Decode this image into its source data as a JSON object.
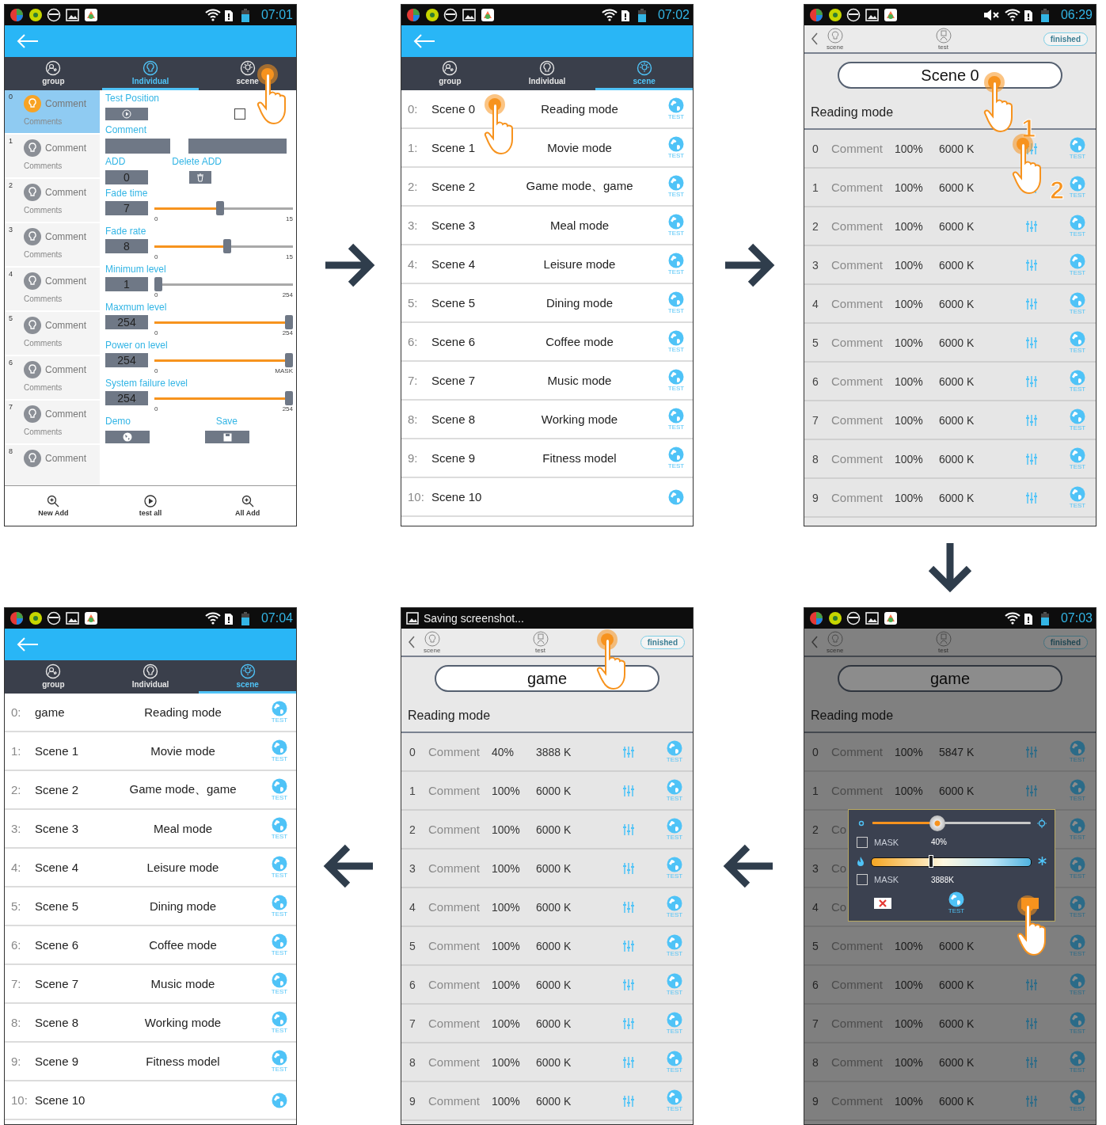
{
  "screens": [
    {
      "kind": "individual",
      "status": {
        "time": "07:01",
        "sound_muted": false
      },
      "tabs": [
        {
          "label": "group",
          "selected": false
        },
        {
          "label": "Individual",
          "selected": true
        },
        {
          "label": "scene",
          "selected": false
        }
      ],
      "devices": [
        {
          "number": "0",
          "title": "Comment",
          "subtitle": "Comments",
          "selected": true
        },
        {
          "number": "1",
          "title": "Comment",
          "subtitle": "Comments",
          "selected": false
        },
        {
          "number": "2",
          "title": "Comment",
          "subtitle": "Comments",
          "selected": false
        },
        {
          "number": "3",
          "title": "Comment",
          "subtitle": "Comments",
          "selected": false
        },
        {
          "number": "4",
          "title": "Comment",
          "subtitle": "Comments",
          "selected": false
        },
        {
          "number": "5",
          "title": "Comment",
          "subtitle": "Comments",
          "selected": false
        },
        {
          "number": "6",
          "title": "Comment",
          "subtitle": "Comments",
          "selected": false
        },
        {
          "number": "7",
          "title": "Comment",
          "subtitle": "Comments",
          "selected": false
        },
        {
          "number": "8",
          "title": "Comment",
          "selected": false
        }
      ],
      "settings": {
        "test_position": {
          "label": "Test Position",
          "checked": false
        },
        "comment": {
          "label": "Comment"
        },
        "add": {
          "label": "ADD",
          "value": "0"
        },
        "delete_add": {
          "label": "Delete ADD"
        },
        "sliders": [
          {
            "label": "Fade time",
            "value": "7",
            "level": 0.47,
            "min": "0",
            "max": "15"
          },
          {
            "label": "Fade rate",
            "value": "8",
            "level": 0.53,
            "min": "0",
            "max": "15"
          },
          {
            "label": "Minimum level",
            "value": "1",
            "level": 0.0,
            "min": "0",
            "max": "254"
          },
          {
            "label": "Maxmum level",
            "value": "254",
            "level": 1.0,
            "min": "0",
            "max": "254"
          },
          {
            "label": "Power on level",
            "value": "254",
            "level": 1.0,
            "min": "0",
            "max": "MASK"
          },
          {
            "label": "System failure level",
            "value": "254",
            "level": 1.0,
            "min": "0",
            "max": "254"
          }
        ],
        "demo": {
          "label": "Demo"
        },
        "save": {
          "label": "Save"
        }
      },
      "bottom_nav": [
        {
          "label": "New Add"
        },
        {
          "label": "test all"
        },
        {
          "label": "All Add"
        }
      ],
      "pointers": [
        {
          "kind": "tap"
        }
      ]
    },
    {
      "kind": "scene_list",
      "status": {
        "time": "07:02",
        "sound_muted": false
      },
      "tabs": [
        {
          "label": "group",
          "selected": false
        },
        {
          "label": "Individual",
          "selected": false
        },
        {
          "label": "scene",
          "selected": true
        }
      ],
      "scenes": [
        {
          "index": "0:",
          "name": "Scene 0",
          "mode": "Reading mode",
          "badge": "TEST"
        },
        {
          "index": "1:",
          "name": "Scene 1",
          "mode": "Movie mode",
          "badge": "TEST"
        },
        {
          "index": "2:",
          "name": "Scene 2",
          "mode": "Game mode、game",
          "badge": "TEST"
        },
        {
          "index": "3:",
          "name": "Scene 3",
          "mode": "Meal mode",
          "badge": "TEST"
        },
        {
          "index": "4:",
          "name": "Scene 4",
          "mode": "Leisure mode",
          "badge": "TEST"
        },
        {
          "index": "5:",
          "name": "Scene 5",
          "mode": "Dining mode",
          "badge": "TEST"
        },
        {
          "index": "6:",
          "name": "Scene 6",
          "mode": "Coffee mode",
          "badge": "TEST"
        },
        {
          "index": "7:",
          "name": "Scene 7",
          "mode": "Music mode",
          "badge": "TEST"
        },
        {
          "index": "8:",
          "name": "Scene 8",
          "mode": "Working mode",
          "badge": "TEST"
        },
        {
          "index": "9:",
          "name": "Scene 9",
          "mode": "Fitness model",
          "badge": "TEST"
        },
        {
          "index": "10:",
          "name": "Scene 10"
        }
      ],
      "pointers": [
        {
          "kind": "tap"
        }
      ]
    },
    {
      "kind": "scene_edit",
      "status": {
        "time": "06:29",
        "sound_muted": true
      },
      "dimmed": false,
      "header": {
        "scene_label": "scene",
        "test_label": "test",
        "finished": "finished"
      },
      "name": "Scene 0",
      "subtitle": "Reading mode",
      "rows": [
        {
          "number": "0",
          "comment": "Comment",
          "brightness": "100%",
          "temp": "6000 K",
          "badge": "TEST"
        },
        {
          "number": "1",
          "comment": "Comment",
          "brightness": "100%",
          "temp": "6000 K",
          "badge": "TEST"
        },
        {
          "number": "2",
          "comment": "Comment",
          "brightness": "100%",
          "temp": "6000 K",
          "badge": "TEST"
        },
        {
          "number": "3",
          "comment": "Comment",
          "brightness": "100%",
          "temp": "6000 K",
          "badge": "TEST"
        },
        {
          "number": "4",
          "comment": "Comment",
          "brightness": "100%",
          "temp": "6000 K",
          "badge": "TEST"
        },
        {
          "number": "5",
          "comment": "Comment",
          "brightness": "100%",
          "temp": "6000 K",
          "badge": "TEST"
        },
        {
          "number": "6",
          "comment": "Comment",
          "brightness": "100%",
          "temp": "6000 K",
          "badge": "TEST"
        },
        {
          "number": "7",
          "comment": "Comment",
          "brightness": "100%",
          "temp": "6000 K",
          "badge": "TEST"
        },
        {
          "number": "8",
          "comment": "Comment",
          "brightness": "100%",
          "temp": "6000 K",
          "badge": "TEST"
        },
        {
          "number": "9",
          "comment": "Comment",
          "brightness": "100%",
          "temp": "6000 K",
          "badge": "TEST"
        }
      ],
      "pointers": [
        {
          "kind": "tap",
          "label": "1"
        },
        {
          "kind": "tap",
          "label": "2"
        }
      ]
    },
    {
      "kind": "scene_list",
      "status": {
        "time": "07:04",
        "sound_muted": false
      },
      "tabs": [
        {
          "label": "group",
          "selected": false
        },
        {
          "label": "Individual",
          "selected": false
        },
        {
          "label": "scene",
          "selected": true
        }
      ],
      "scenes": [
        {
          "index": "0:",
          "name": "game",
          "mode": "Reading mode",
          "badge": "TEST"
        },
        {
          "index": "1:",
          "name": "Scene 1",
          "mode": "Movie mode",
          "badge": "TEST"
        },
        {
          "index": "2:",
          "name": "Scene 2",
          "mode": "Game mode、game",
          "badge": "TEST"
        },
        {
          "index": "3:",
          "name": "Scene 3",
          "mode": "Meal mode",
          "badge": "TEST"
        },
        {
          "index": "4:",
          "name": "Scene 4",
          "mode": "Leisure mode",
          "badge": "TEST"
        },
        {
          "index": "5:",
          "name": "Scene 5",
          "mode": "Dining mode",
          "badge": "TEST"
        },
        {
          "index": "6:",
          "name": "Scene 6",
          "mode": "Coffee mode",
          "badge": "TEST"
        },
        {
          "index": "7:",
          "name": "Scene 7",
          "mode": "Music mode",
          "badge": "TEST"
        },
        {
          "index": "8:",
          "name": "Scene 8",
          "mode": "Working mode",
          "badge": "TEST"
        },
        {
          "index": "9:",
          "name": "Scene 9",
          "mode": "Fitness model",
          "badge": "TEST"
        },
        {
          "index": "10:",
          "name": "Scene 10"
        }
      ]
    },
    {
      "kind": "scene_edit",
      "status": {
        "notification": "Saving screenshot..."
      },
      "dimmed": false,
      "header": {
        "scene_label": "scene",
        "test_label": "test",
        "finished": "finished"
      },
      "name": "game",
      "subtitle": "Reading mode",
      "rows": [
        {
          "number": "0",
          "comment": "Comment",
          "brightness": "40%",
          "temp": "3888 K",
          "badge": "TEST"
        },
        {
          "number": "1",
          "comment": "Comment",
          "brightness": "100%",
          "temp": "6000 K",
          "badge": "TEST"
        },
        {
          "number": "2",
          "comment": "Comment",
          "brightness": "100%",
          "temp": "6000 K",
          "badge": "TEST"
        },
        {
          "number": "3",
          "comment": "Comment",
          "brightness": "100%",
          "temp": "6000 K",
          "badge": "TEST"
        },
        {
          "number": "4",
          "comment": "Comment",
          "brightness": "100%",
          "temp": "6000 K",
          "badge": "TEST"
        },
        {
          "number": "5",
          "comment": "Comment",
          "brightness": "100%",
          "temp": "6000 K",
          "badge": "TEST"
        },
        {
          "number": "6",
          "comment": "Comment",
          "brightness": "100%",
          "temp": "6000 K",
          "badge": "TEST"
        },
        {
          "number": "7",
          "comment": "Comment",
          "brightness": "100%",
          "temp": "6000 K",
          "badge": "TEST"
        },
        {
          "number": "8",
          "comment": "Comment",
          "brightness": "100%",
          "temp": "6000 K",
          "badge": "TEST"
        },
        {
          "number": "9",
          "comment": "Comment",
          "brightness": "100%",
          "temp": "6000 K",
          "badge": "TEST"
        }
      ],
      "pointers": [
        {
          "kind": "tap"
        }
      ]
    },
    {
      "kind": "scene_edit",
      "status": {
        "time": "07:03",
        "sound_muted": false
      },
      "dimmed": true,
      "header": {
        "scene_label": "scene",
        "test_label": "test",
        "finished": "finished"
      },
      "name": "game",
      "subtitle": "Reading mode",
      "rows": [
        {
          "number": "0",
          "comment": "Comment",
          "brightness": "100%",
          "temp": "5847 K",
          "badge": "TEST"
        },
        {
          "number": "1",
          "comment": "Comment",
          "brightness": "100%",
          "temp": "6000 K",
          "badge": "TEST"
        },
        {
          "number": "2",
          "comment": "Co",
          "badge": "TEST"
        },
        {
          "number": "3",
          "comment": "Co",
          "badge": "TEST"
        },
        {
          "number": "4",
          "comment": "Co",
          "badge": "TEST"
        },
        {
          "number": "5",
          "comment": "Comment",
          "brightness": "100%",
          "temp": "6000 K",
          "badge": "TEST"
        },
        {
          "number": "6",
          "comment": "Comment",
          "brightness": "100%",
          "temp": "6000 K",
          "badge": "TEST"
        },
        {
          "number": "7",
          "comment": "Comment",
          "brightness": "100%",
          "temp": "6000 K",
          "badge": "TEST"
        },
        {
          "number": "8",
          "comment": "Comment",
          "brightness": "100%",
          "temp": "6000 K",
          "badge": "TEST"
        },
        {
          "number": "9",
          "comment": "Comment",
          "brightness": "100%",
          "temp": "6000 K",
          "badge": "TEST"
        }
      ],
      "dialog": {
        "brightness": {
          "level": 0.4,
          "mask": {
            "label": "MASK",
            "checked": false
          },
          "reading": "40%"
        },
        "temperature": {
          "level": 0.37,
          "mask": {
            "label": "MASK",
            "checked": false
          },
          "reading": "3888K"
        },
        "test_badge": "TEST"
      },
      "pointers": [
        {
          "kind": "tap"
        }
      ]
    }
  ]
}
